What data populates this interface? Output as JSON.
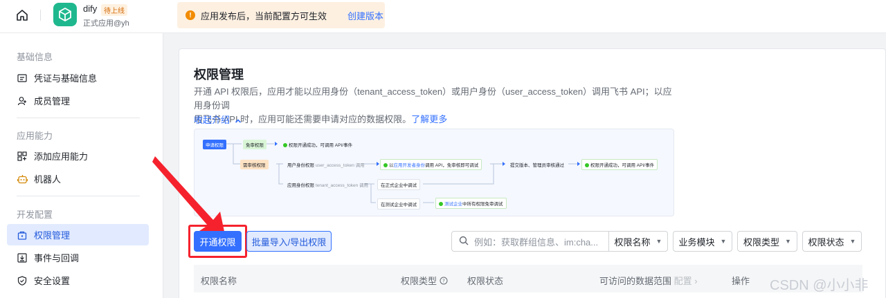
{
  "header": {
    "app_name": "dify",
    "app_badge": "待上线",
    "app_subtitle": "正式应用@yh",
    "notice_text": "应用发布后，当前配置方可生效",
    "notice_link": "创建版本"
  },
  "sidebar": {
    "sections": [
      {
        "title": "基础信息",
        "items": [
          {
            "label": "凭证与基础信息",
            "icon": "credential-icon"
          },
          {
            "label": "成员管理",
            "icon": "member-icon"
          }
        ]
      },
      {
        "title": "应用能力",
        "items": [
          {
            "label": "添加应用能力",
            "icon": "add-capability-icon"
          },
          {
            "label": "机器人",
            "icon": "robot-icon"
          }
        ]
      },
      {
        "title": "开发配置",
        "items": [
          {
            "label": "权限管理",
            "icon": "permission-icon",
            "active": true
          },
          {
            "label": "事件与回调",
            "icon": "event-icon"
          },
          {
            "label": "安全设置",
            "icon": "shield-icon"
          }
        ]
      }
    ]
  },
  "main": {
    "title": "权限管理",
    "desc_line1": "开通 API 权限后，应用才能以应用身份（tenant_access_token）或用户身份（user_access_token）调用飞书 API；以应用身份调",
    "desc_line2": "用飞书 API 时，应用可能还需要申请对应的数据权限。",
    "learn_more": "了解更多",
    "collapse": "收起介绍",
    "flow": {
      "apply": "申请权限",
      "free": "免审权限",
      "free_ok": "权限开通成功，可调用 API/事件",
      "need": "需审核权限",
      "user_id": "用户身份权限",
      "user_token": "user_access_token 调用",
      "dev_debug_a": "以",
      "dev_debug_b": "应用开发者身份",
      "dev_debug_c": "调用 API，免审核即可调试",
      "submit": "提交版本、管理员审核通过",
      "final_ok": "权限开通成功，可调用 API/事件",
      "app_id": "应用身份权限",
      "tenant_token": "tenant_access_token 调用",
      "prod_debug": "在正式企业中调试",
      "test_debug": "在测试企业中调试",
      "test_ok_a": "测试企业",
      "test_ok_b": "中所有权限免审调试"
    },
    "toolbar": {
      "enable_btn": "开通权限",
      "batch_btn": "批量导入/导出权限",
      "search_placeholder": "例如：获取群组信息、im:cha...",
      "filters": [
        "权限名称",
        "业务模块",
        "权限类型",
        "权限状态"
      ]
    },
    "table_headers": [
      "权限名称",
      "权限类型",
      "权限状态",
      "可访问的数据范围",
      "配置",
      "操作"
    ]
  },
  "watermark": "CSDN @小小非",
  "colors": {
    "accent": "#3370ff",
    "highlight": "#f5222d"
  }
}
